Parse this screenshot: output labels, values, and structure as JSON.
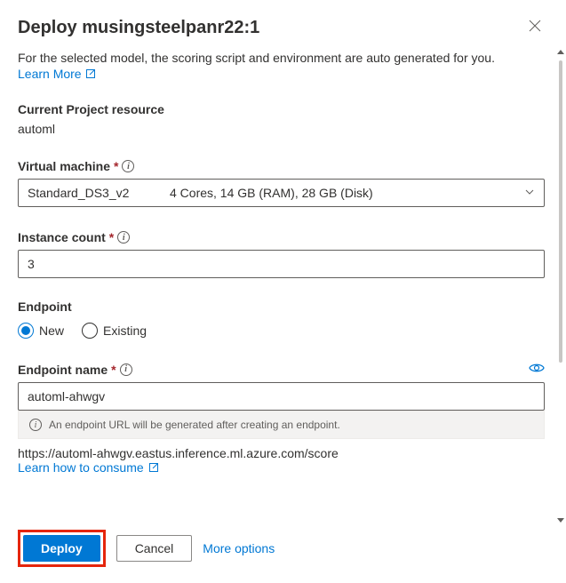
{
  "header": {
    "title": "Deploy musingsteelpanr22:1"
  },
  "description": "For the selected model, the scoring script and environment are auto generated for you.",
  "learn_more_label": "Learn More",
  "project": {
    "label": "Current Project resource",
    "value": "automl"
  },
  "vm": {
    "label": "Virtual machine",
    "selected_name": "Standard_DS3_v2",
    "selected_spec": "4 Cores, 14 GB (RAM), 28 GB (Disk)"
  },
  "instance": {
    "label": "Instance count",
    "value": "3"
  },
  "endpoint": {
    "label": "Endpoint",
    "options": {
      "new": "New",
      "existing": "Existing"
    },
    "name_label": "Endpoint name",
    "name_value": "automl-ahwgv",
    "info_banner": "An endpoint URL will be generated after creating an endpoint.",
    "url": "https://automl-ahwgv.eastus.inference.ml.azure.com/score",
    "consume_link": "Learn how to consume"
  },
  "footer": {
    "deploy": "Deploy",
    "cancel": "Cancel",
    "more": "More options"
  }
}
